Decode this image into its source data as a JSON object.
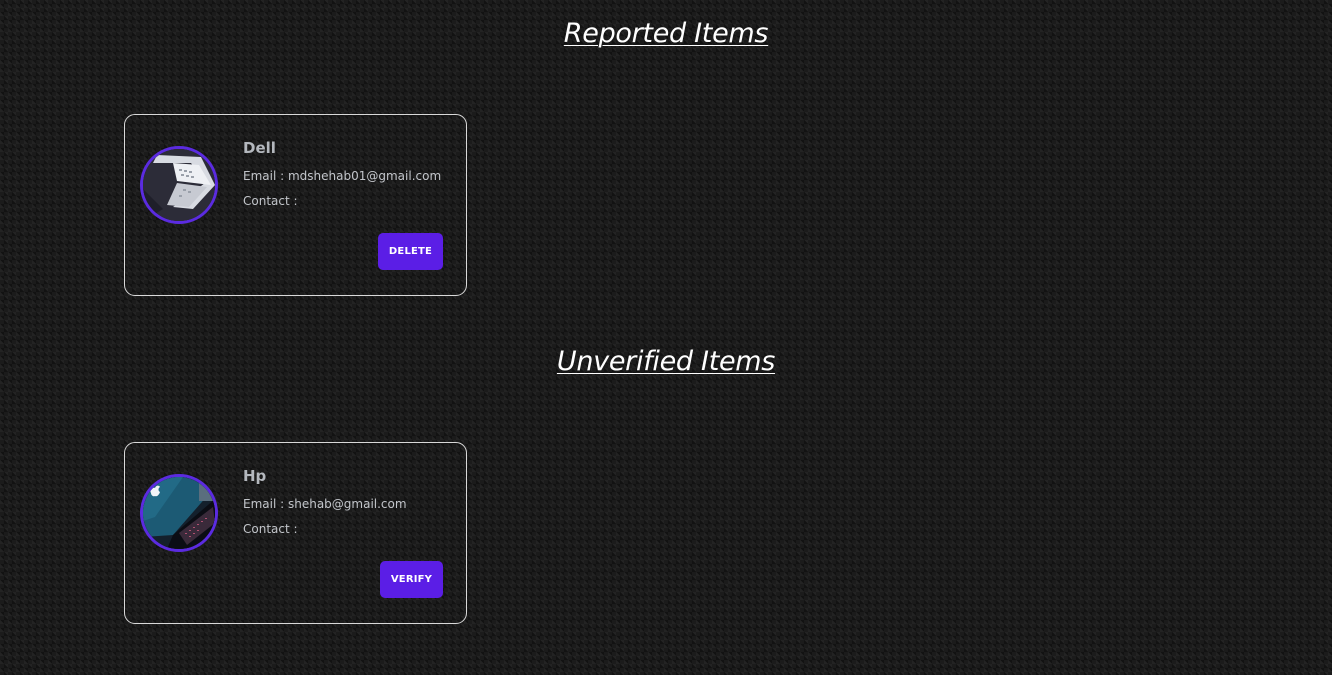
{
  "reported": {
    "title": "Reported Items",
    "items": [
      {
        "name": "Dell",
        "email_label": "Email : ",
        "email": "mdshehab01@gmail.com",
        "contact_label": "Contact : ",
        "contact": "",
        "action_label": "DELETE",
        "image_icon": "laptop-photo-icon"
      }
    ]
  },
  "unverified": {
    "title": "Unverified Items",
    "items": [
      {
        "name": "Hp",
        "email_label": "Email : ",
        "email": "shehab@gmail.com",
        "contact_label": "Contact : ",
        "contact": "",
        "action_label": "VERIFY",
        "image_icon": "laptop-photo-icon"
      }
    ]
  },
  "colors": {
    "accent": "#5b1ee6",
    "avatar_ring": "#5b2be0",
    "card_border": "#d9d9d9",
    "background": "#1b1b1b"
  }
}
